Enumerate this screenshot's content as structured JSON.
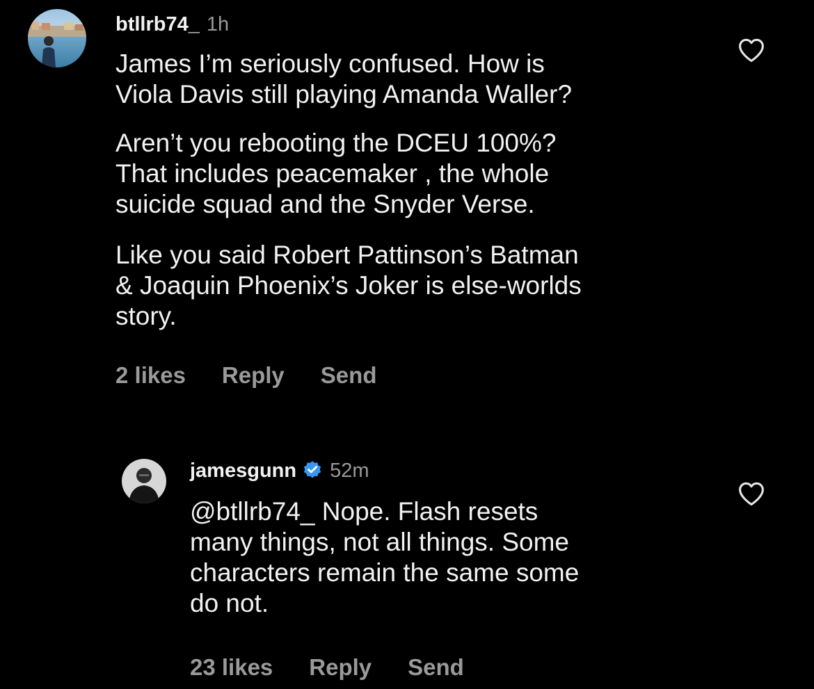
{
  "comments": [
    {
      "username": "btllrb74_",
      "time": "1h",
      "verified": false,
      "paragraphs": [
        "James I’m seriously confused.  How is\nViola Davis still playing Amanda Waller?",
        "Aren’t you rebooting the DCEU 100%?\nThat includes peacemaker , the whole\nsuicide squad and the Snyder Verse.",
        "Like you said Robert Pattinson’s Batman\n& Joaquin Phoenix’s Joker is else-worlds\nstory."
      ],
      "likes": "2 likes",
      "reply": "Reply",
      "send": "Send"
    },
    {
      "username": "jamesgunn",
      "time": "52m",
      "verified": true,
      "paragraphs": [
        "@btllrb74_ Nope. Flash resets\nmany things, not all things. Some\ncharacters remain the same some\ndo not."
      ],
      "likes": "23 likes",
      "reply": "Reply",
      "send": "Send"
    }
  ],
  "icons": {
    "like": "heart-outline-icon",
    "verified": "verified-badge-icon"
  },
  "colors": {
    "background": "#000000",
    "text": "#f2f2f2",
    "secondary": "#9a9a9a",
    "verified": "#3897f0"
  }
}
